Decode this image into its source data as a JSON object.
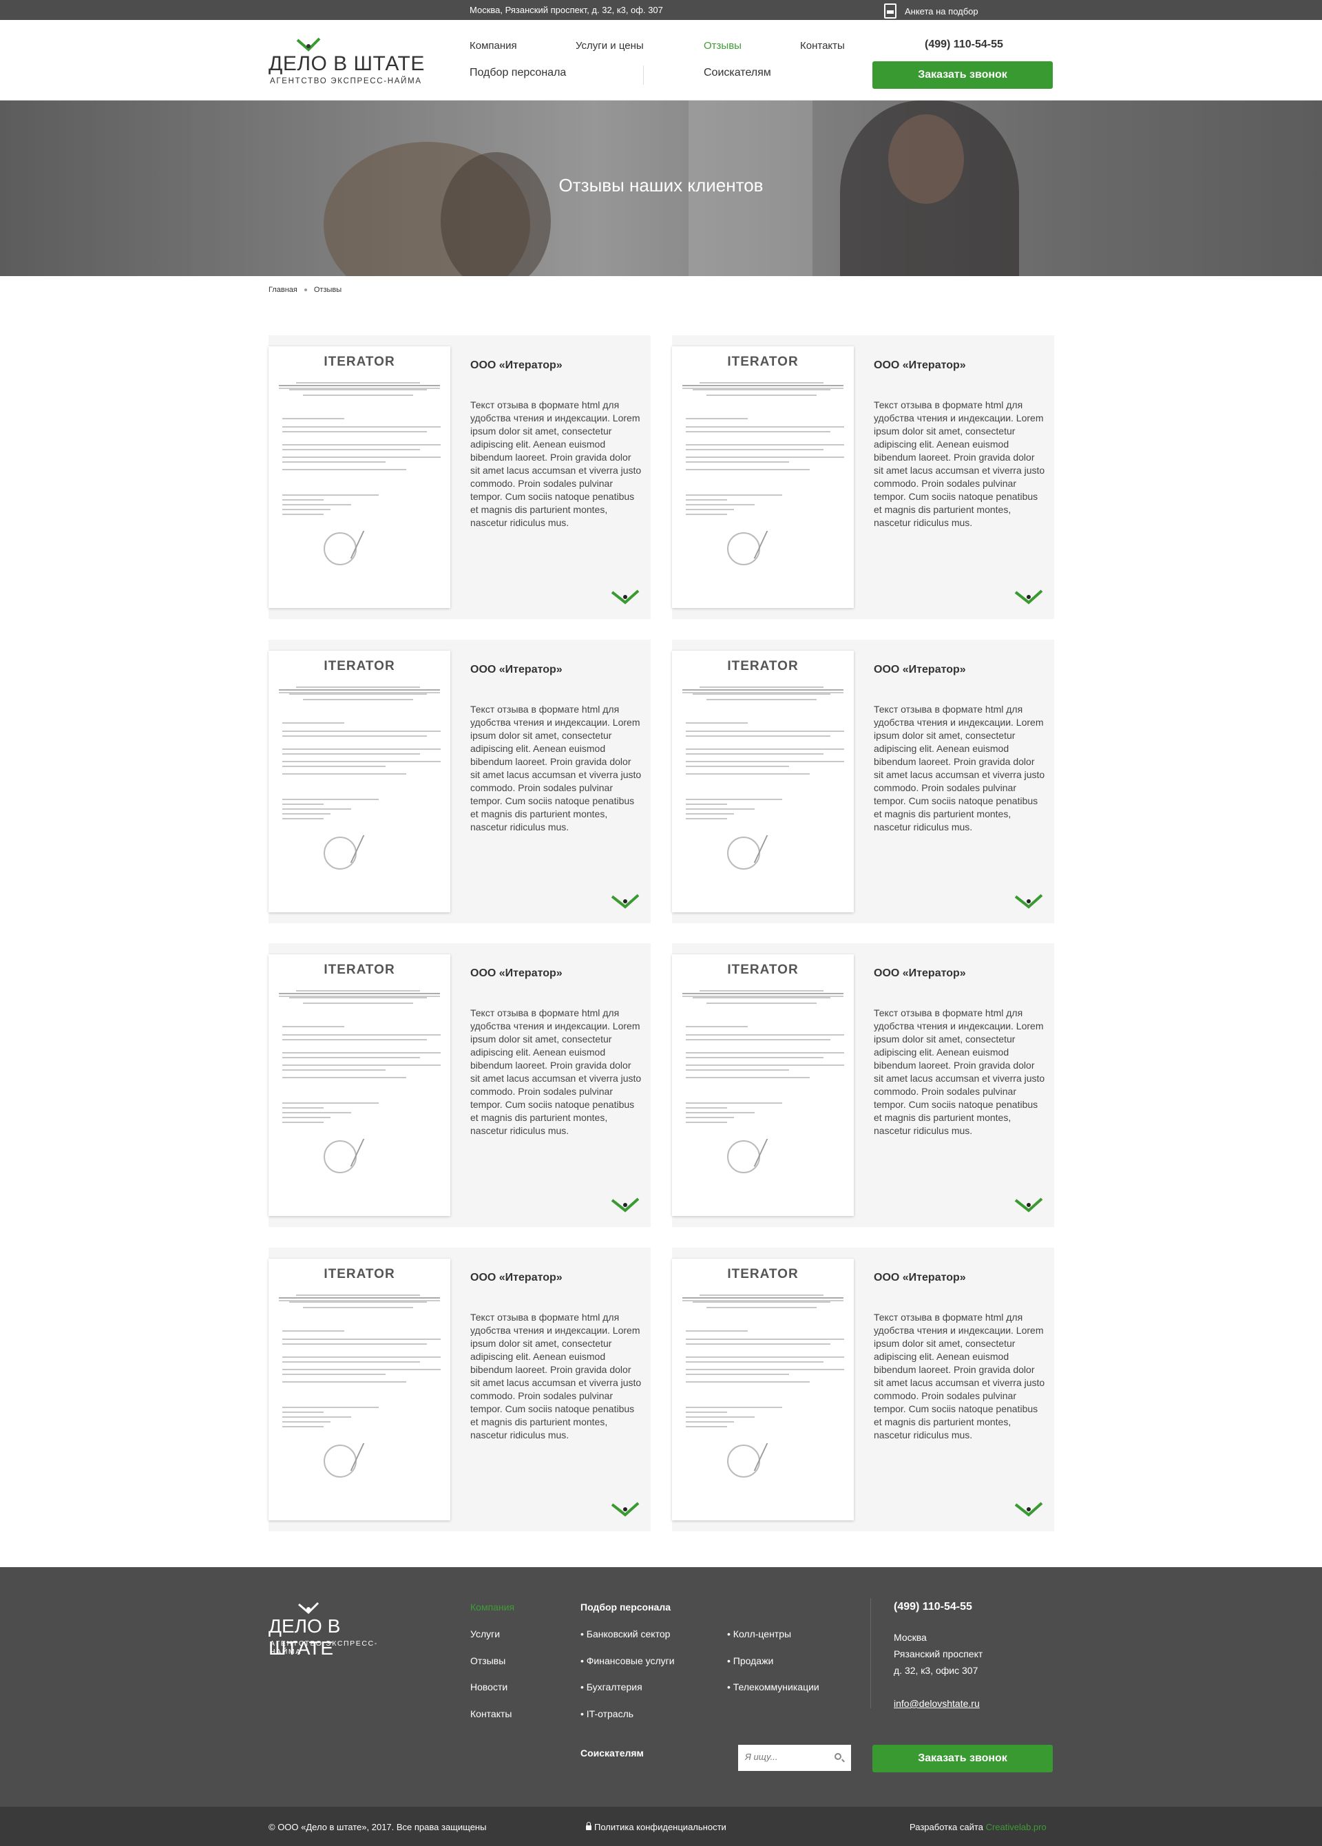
{
  "topbar": {
    "address": "Москва, Рязанский проспект, д. 32, к3, оф. 307",
    "anketa": "Анкета на подбор"
  },
  "header": {
    "logo_name": "ДЕЛО В ШТАТЕ",
    "logo_tag": "АГЕНТСТВО ЭКСПРЕСС-НАЙМА",
    "nav": {
      "company": "Компания",
      "services": "Услуги и цены",
      "reviews": "Отзывы",
      "contacts": "Контакты",
      "selection": "Подбор персонала",
      "applicants": "Соискателям"
    },
    "phone": "(499) 110-54-55",
    "callback": "Заказать звонок"
  },
  "hero": {
    "title": "Отзывы наших клиентов"
  },
  "breadcrumb": {
    "home": "Главная",
    "current": "Отзывы"
  },
  "reviews": [
    {
      "company": "ООО «Итератор»",
      "letterhead": "ITERATOR",
      "text": "Текст отзыва в формате html для удобства чтения и индексации. Lorem ipsum dolor sit amet, consectetur adipiscing elit. Aenean euismod bibendum laoreet. Proin gravida dolor sit amet lacus accumsan et viverra justo commodo. Proin sodales pulvinar tempor. Cum sociis natoque penatibus et magnis dis parturient montes, nascetur ridiculus mus."
    },
    {
      "company": "ООО «Итератор»",
      "letterhead": "ITERATOR",
      "text": "Текст отзыва в формате html для удобства чтения и индексации. Lorem ipsum dolor sit amet, consectetur adipiscing elit. Aenean euismod bibendum laoreet. Proin gravida dolor sit amet lacus accumsan et viverra justo commodo. Proin sodales pulvinar tempor. Cum sociis natoque penatibus et magnis dis parturient montes, nascetur ridiculus mus."
    },
    {
      "company": "ООО «Итератор»",
      "letterhead": "ITERATOR",
      "text": "Текст отзыва в формате html для удобства чтения и индексации. Lorem ipsum dolor sit amet, consectetur adipiscing elit. Aenean euismod bibendum laoreet. Proin gravida dolor sit amet lacus accumsan et viverra justo commodo. Proin sodales pulvinar tempor. Cum sociis natoque penatibus et magnis dis parturient montes, nascetur ridiculus mus."
    },
    {
      "company": "ООО «Итератор»",
      "letterhead": "ITERATOR",
      "text": "Текст отзыва в формате html для удобства чтения и индексации. Lorem ipsum dolor sit amet, consectetur adipiscing elit. Aenean euismod bibendum laoreet. Proin gravida dolor sit amet lacus accumsan et viverra justo commodo. Proin sodales pulvinar tempor. Cum sociis natoque penatibus et magnis dis parturient montes, nascetur ridiculus mus."
    },
    {
      "company": "ООО «Итератор»",
      "letterhead": "ITERATOR",
      "text": "Текст отзыва в формате html для удобства чтения и индексации. Lorem ipsum dolor sit amet, consectetur adipiscing elit. Aenean euismod bibendum laoreet. Proin gravida dolor sit amet lacus accumsan et viverra justo commodo. Proin sodales pulvinar tempor. Cum sociis natoque penatibus et magnis dis parturient montes, nascetur ridiculus mus."
    },
    {
      "company": "ООО «Итератор»",
      "letterhead": "ITERATOR",
      "text": "Текст отзыва в формате html для удобства чтения и индексации. Lorem ipsum dolor sit amet, consectetur adipiscing elit. Aenean euismod bibendum laoreet. Proin gravida dolor sit amet lacus accumsan et viverra justo commodo. Proin sodales pulvinar tempor. Cum sociis natoque penatibus et magnis dis parturient montes, nascetur ridiculus mus."
    },
    {
      "company": "ООО «Итератор»",
      "letterhead": "ITERATOR",
      "text": "Текст отзыва в формате html для удобства чтения и индексации. Lorem ipsum dolor sit amet, consectetur adipiscing elit. Aenean euismod bibendum laoreet. Proin gravida dolor sit amet lacus accumsan et viverra justo commodo. Proin sodales pulvinar tempor. Cum sociis natoque penatibus et magnis dis parturient montes, nascetur ridiculus mus."
    },
    {
      "company": "ООО «Итератор»",
      "letterhead": "ITERATOR",
      "text": "Текст отзыва в формате html для удобства чтения и индексации. Lorem ipsum dolor sit amet, consectetur adipiscing elit. Aenean euismod bibendum laoreet. Proin gravida dolor sit amet lacus accumsan et viverra justo commodo. Proin sodales pulvinar tempor. Cum sociis natoque penatibus et magnis dis parturient montes, nascetur ridiculus mus."
    }
  ],
  "footer": {
    "logo_name": "ДЕЛО В ШТАТЕ",
    "logo_tag": "АГЕНТСТВО ЭКСПРЕСС-НАЙМА",
    "menu": [
      "Компания",
      "Услуги",
      "Отзывы",
      "Новости",
      "Контакты"
    ],
    "selection_head": "Подбор персонала",
    "selection_col1": [
      "• Банковский сектор",
      "• Финансовые услуги",
      "• Бухгалтерия",
      "• IT-отрасль"
    ],
    "selection_col2": [
      "• Колл-центры",
      "• Продажи",
      "• Телекоммуникации"
    ],
    "applicants": "Соискателям",
    "search_placeholder": "Я ищу...",
    "phone": "(499) 110-54-55",
    "address": [
      "Москва",
      "Рязанский проспект",
      "д. 32, к3, офис 307"
    ],
    "email": "info@delovshtate.ru",
    "callback": "Заказать звонок"
  },
  "bottombar": {
    "copyright": "© ООО «Дело в штате», 2017. Все права защищены",
    "privacy": "Политика конфиденциальности",
    "dev_label": "Разработка сайта",
    "dev_name": "Creativelab.pro"
  },
  "colors": {
    "accent": "#3a9a32",
    "topbar": "#4d4d4d",
    "footer": "#4d4d4d",
    "bottombar": "#3a3a3a",
    "card": "#f5f5f5"
  }
}
